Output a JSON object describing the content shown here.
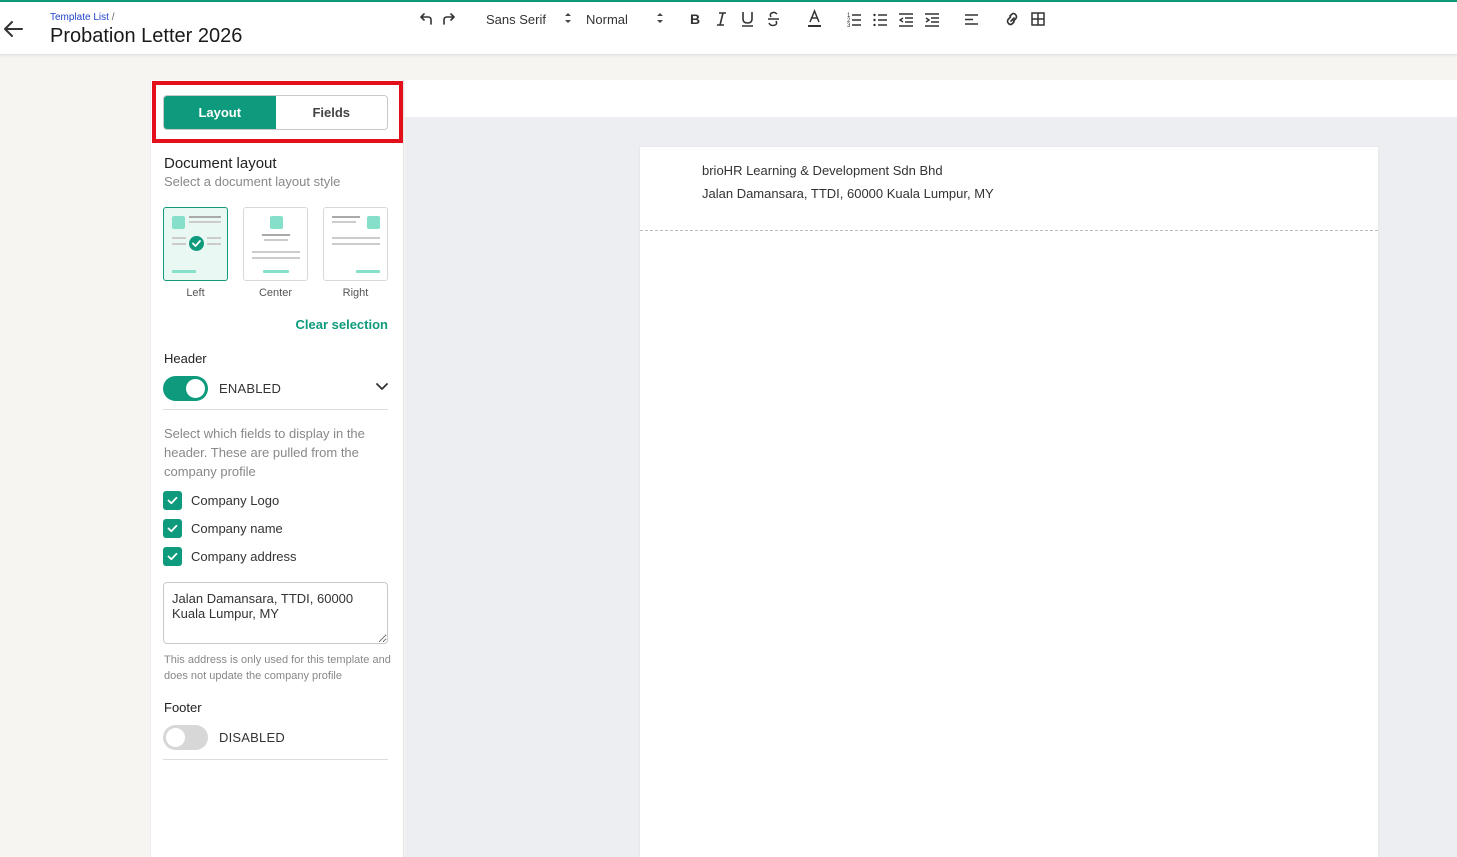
{
  "header": {
    "breadcrumb_link": "Template List",
    "breadcrumb_sep": "/",
    "title": "Probation Letter 2026"
  },
  "sidebar": {
    "tabs": [
      {
        "label": "Layout",
        "active": true
      },
      {
        "label": "Fields",
        "active": false
      }
    ],
    "document_layout": {
      "title": "Document layout",
      "subtitle": "Select a document layout style",
      "options": [
        {
          "label": "Left",
          "selected": true
        },
        {
          "label": "Center",
          "selected": false
        },
        {
          "label": "Right",
          "selected": false
        }
      ],
      "clear_label": "Clear selection"
    },
    "header_section": {
      "label": "Header",
      "toggle_state": "ENABLED",
      "enabled": true,
      "help": "Select which fields to display in the header. These are pulled from the company profile",
      "fields": [
        {
          "label": "Company Logo",
          "checked": true
        },
        {
          "label": "Company name",
          "checked": true
        },
        {
          "label": "Company address",
          "checked": true
        }
      ],
      "address_value": "Jalan Damansara, TTDI, 60000 Kuala Lumpur, MY",
      "address_note": "This address is only used for this template and does not update the company profile"
    },
    "footer_section": {
      "label": "Footer",
      "toggle_state": "DISABLED",
      "enabled": false
    }
  },
  "toolbar": {
    "font_family": "Sans Serif",
    "font_size": "Normal",
    "icons": [
      "undo-icon",
      "redo-icon",
      "bold-icon",
      "italic-icon",
      "underline-icon",
      "strikethrough-icon",
      "text-color-icon",
      "ordered-list-icon",
      "bullet-list-icon",
      "outdent-icon",
      "indent-icon",
      "align-icon",
      "link-icon",
      "table-icon"
    ]
  },
  "document": {
    "company_name": "brioHR Learning & Development Sdn Bhd",
    "company_address": "Jalan Damansara, TTDI, 60000 Kuala Lumpur, MY"
  },
  "colors": {
    "accent": "#0e9a7c",
    "highlight": "#e3101c"
  }
}
